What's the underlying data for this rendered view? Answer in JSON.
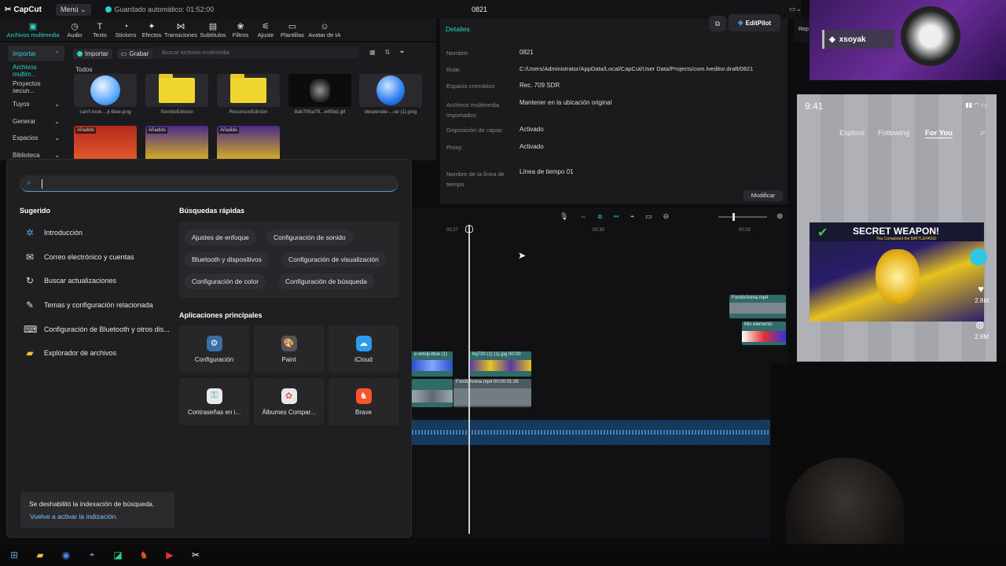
{
  "titlebar": {
    "app_name": "CapCut",
    "menu_label": "Menú",
    "autosave": "Guardado automático: 01:52:00",
    "project_name": "0821",
    "editpilot_label": "EditPilot"
  },
  "toolbar": {
    "tabs": [
      {
        "label": "Archivos multimedia",
        "icon": "media-icon"
      },
      {
        "label": "Audio",
        "icon": "audio-icon"
      },
      {
        "label": "Texto",
        "icon": "text-icon"
      },
      {
        "label": "Stickers",
        "icon": "sticker-icon"
      },
      {
        "label": "Efectos",
        "icon": "effects-icon"
      },
      {
        "label": "Transiciones",
        "icon": "transitions-icon"
      },
      {
        "label": "Subtítulos",
        "icon": "subtitles-icon"
      },
      {
        "label": "Filtros",
        "icon": "filters-icon"
      },
      {
        "label": "Ajuste",
        "icon": "adjust-icon"
      },
      {
        "label": "Plantillas",
        "icon": "templates-icon"
      },
      {
        "label": "Avatar de IA",
        "icon": "ai-avatar-icon"
      }
    ]
  },
  "media": {
    "categories": [
      "Importar",
      "Archivos multim...",
      "Proyectos secun...",
      "Tuyos",
      "Generar",
      "Espacios",
      "Biblioteca"
    ],
    "import_label": "Importar",
    "record_label": "Grabar",
    "search_placeholder": "Buscar archivos multimedia",
    "all_label": "Todos",
    "items": [
      {
        "name": "can't-look-...ji-blue.png",
        "added": ""
      },
      {
        "name": "SonidoEdicion",
        "added": ""
      },
      {
        "name": "RecursosEdicion",
        "added": ""
      },
      {
        "name": "8ab785a79...e65bd.gif",
        "added": ""
      },
      {
        "name": "desperate-...ue (1).png",
        "added": ""
      }
    ],
    "added_label": "Añadido"
  },
  "details": {
    "header": "Detalles",
    "rows": [
      {
        "label": "Nombre:",
        "value": "0821"
      },
      {
        "label": "Ruta:",
        "value": "C:/Users/Administrator/AppData/Local/CapCut/User Data/Projects/com.lveditor.draft/0821"
      },
      {
        "label": "Espacio cromático",
        "value": "Rec. 709 SDR"
      },
      {
        "label": "Archivos multimedia importados:",
        "value": "Mantener en la ubicación original"
      },
      {
        "label": "Disposición de capas",
        "value": "Activado"
      },
      {
        "label": "Proxy:",
        "value": "Activado"
      },
      {
        "label": "Nombre de la línea de tiempo",
        "value": "Línea de tiempo 01"
      }
    ],
    "modify_label": "Modificar"
  },
  "timeline": {
    "ticks": [
      "00:27",
      "00:30",
      "00:33"
    ],
    "clips": [
      {
        "label": "FondoArena.mp4"
      },
      {
        "label": "Mix elemento"
      },
      {
        "label": "e-emoji-blue (1)"
      },
      {
        "label": "hq720 (1) (1).jpg   00:00:"
      },
      {
        "label": "FondoArena.mp4   00:00:01:39"
      }
    ]
  },
  "stream": {
    "username": "xsoyak"
  },
  "phone": {
    "time": "9:41",
    "tabs": [
      "Explore",
      "Following",
      "For You"
    ],
    "banner_title": "SECRET WEAPON!",
    "banner_sub": "You Completed the BATTLEPASS!",
    "likes": "2.8M",
    "comments": "2.8M"
  },
  "startmenu": {
    "suggested_title": "Sugerido",
    "suggested": [
      {
        "label": "Introducción",
        "icon": "intro-icon"
      },
      {
        "label": "Correo electrónico y cuentas",
        "icon": "mail-icon"
      },
      {
        "label": "Buscar actualizaciones",
        "icon": "refresh-icon"
      },
      {
        "label": "Temas y configuración relacionada",
        "icon": "brush-icon"
      },
      {
        "label": "Configuración de Bluetooth y otros dis...",
        "icon": "bluetooth-devices-icon"
      },
      {
        "label": "Explorador de archivos",
        "icon": "folder-icon"
      }
    ],
    "quick_title": "Búsquedas rápidas",
    "quick": [
      "Ajustes de enfoque",
      "Configuración de sonido",
      "Bluetooth y dispositivos",
      "Configuración de visualización",
      "Configuración de color",
      "Configuración de búsqueda"
    ],
    "apps_title": "Aplicaciones principales",
    "apps": [
      {
        "label": "Configuración",
        "color": "#3a6ea5"
      },
      {
        "label": "Paint",
        "color": "#444"
      },
      {
        "label": "iCloud",
        "color": "#2d9bf0"
      },
      {
        "label": "Contraseñas en i...",
        "color": "#e8e8e8"
      },
      {
        "label": "Álbumes Compar...",
        "color": "#e8e8e8"
      },
      {
        "label": "Brave",
        "color": "#fb542b"
      }
    ],
    "notice_line1": "Se deshabilitó la indexación de búsqueda.",
    "notice_line2": "Vuelve a activar la indización."
  },
  "taskbar": {
    "icons": [
      "windows-start-icon",
      "file-explorer-icon",
      "chrome-icon",
      "discord-icon",
      "app-green-icon",
      "brave-icon",
      "youtube-icon",
      "capcut-icon"
    ]
  }
}
